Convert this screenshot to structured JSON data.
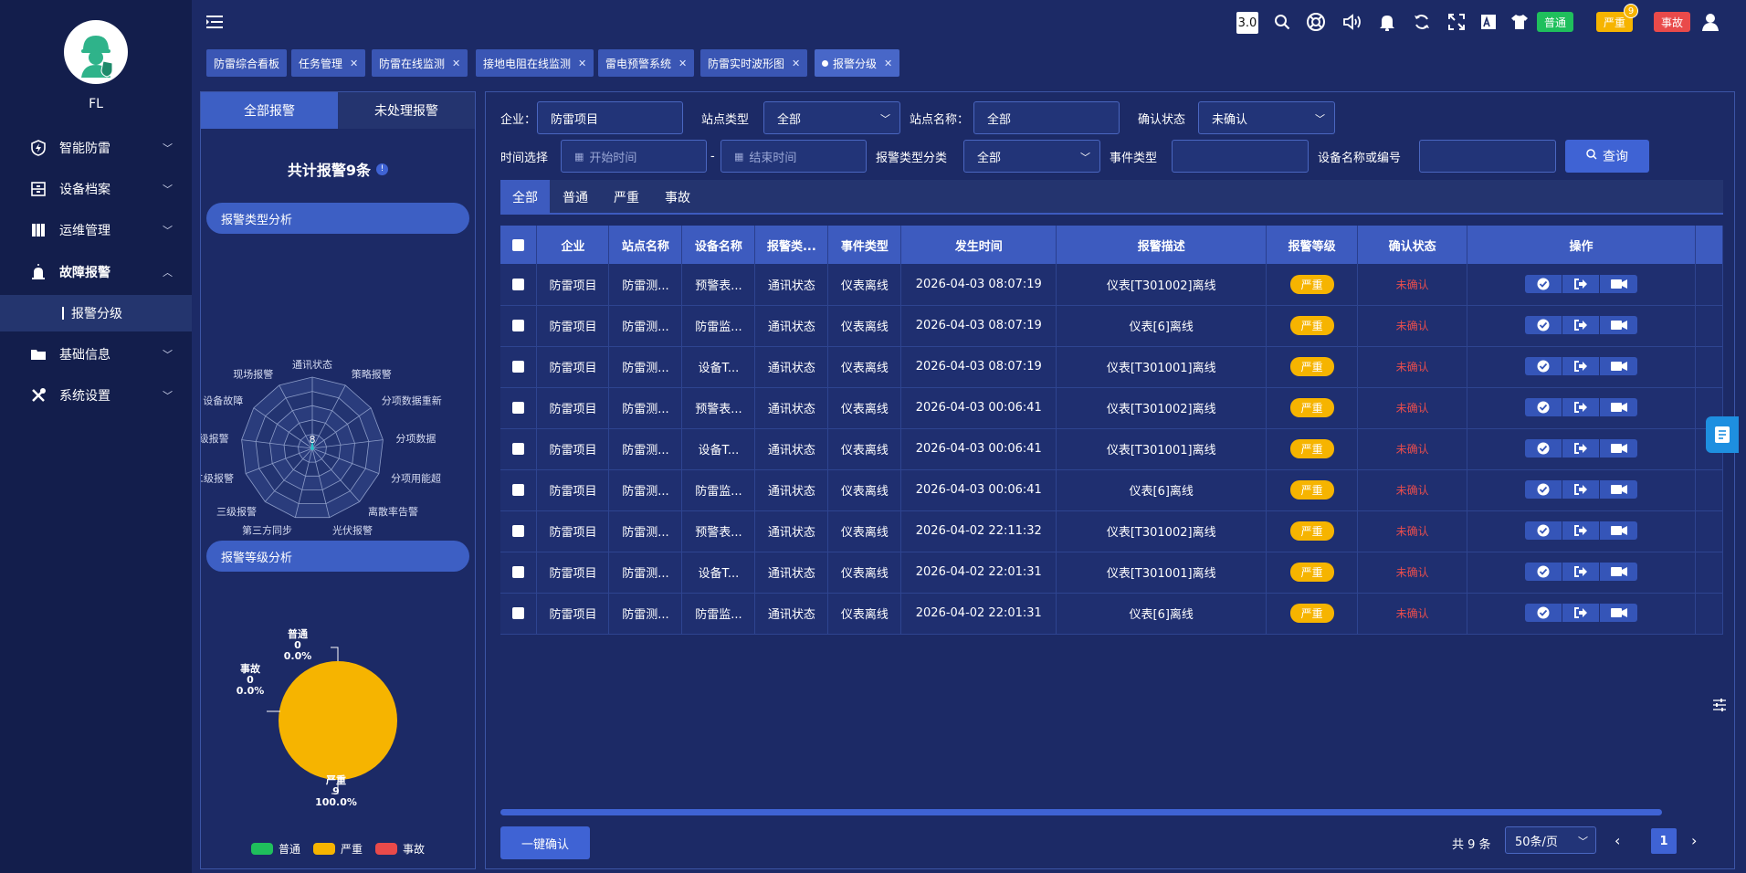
{
  "user": {
    "name": "FL"
  },
  "sidebar": {
    "items": [
      {
        "label": "智能防雷",
        "icon": "lightning-shield-icon"
      },
      {
        "label": "设备档案",
        "icon": "archive-icon"
      },
      {
        "label": "运维管理",
        "icon": "binders-icon"
      },
      {
        "label": "故障报警",
        "icon": "alarm-icon"
      },
      {
        "label": "基础信息",
        "icon": "folder-icon"
      },
      {
        "label": "系统设置",
        "icon": "tools-icon"
      }
    ],
    "sub_item": "报警分级"
  },
  "topbar": {
    "version": "3.0",
    "normal_label": "普通",
    "severe_label": "严重",
    "severe_count": "9",
    "accident_label": "事故",
    "colors": {
      "normal": "#1fbf5c",
      "severe": "#f6b400",
      "accident": "#e94a4a"
    }
  },
  "tabs": [
    {
      "label": "防雷综合看板",
      "closable": false
    },
    {
      "label": "任务管理",
      "closable": true
    },
    {
      "label": "防雷在线监测",
      "closable": true
    },
    {
      "label": "接地电阻在线监测",
      "closable": true
    },
    {
      "label": "雷电预警系统",
      "closable": true
    },
    {
      "label": "防雷实时波形图",
      "closable": true
    },
    {
      "label": "报警分级",
      "closable": true,
      "active": true
    }
  ],
  "left_panel": {
    "tab_all": "全部报警",
    "tab_unhandled": "未处理报警",
    "total_label": "共计报警9条",
    "type_analysis_title": "报警类型分析",
    "radar_labels": [
      "通讯状态",
      "策略报警",
      "分项数据重新",
      "分项数据",
      "分项用能超",
      "离散率告警",
      "光伏报警",
      "第三方同步",
      "三级报警",
      "二级报警",
      "一级报警",
      "设备故障",
      "现场报警"
    ],
    "radar_center_value": "8",
    "level_analysis_title": "报警等级分析",
    "pie": {
      "slices": [
        {
          "name": "普通",
          "value": 0,
          "pct": "0.0%",
          "color": "#1fbf5c"
        },
        {
          "name": "事故",
          "value": 0,
          "pct": "0.0%",
          "color": "#e94a4a"
        },
        {
          "name": "严重",
          "value": 9,
          "pct": "100.0%",
          "color": "#f6b400"
        }
      ]
    },
    "legend": [
      "普通",
      "严重",
      "事故"
    ]
  },
  "filters": {
    "company_label": "企业：",
    "company_value": "防雷项目",
    "site_type_label": "站点类型",
    "site_type_value": "全部",
    "site_name_label": "站点名称：",
    "site_name_value": "全部",
    "confirm_label": "确认状态",
    "confirm_value": "未确认",
    "time_label": "时间选择",
    "start_placeholder": "开始时间",
    "dash": "-",
    "end_placeholder": "结束时间",
    "alarm_class_label": "报警类型分类",
    "alarm_class_value": "全部",
    "event_type_label": "事件类型",
    "device_label": "设备名称或编号",
    "query_label": "查询"
  },
  "sub_tabs": [
    "全部",
    "普通",
    "严重",
    "事故"
  ],
  "table": {
    "headers": [
      "企业",
      "站点名称",
      "设备名称",
      "报警类...",
      "事件类型",
      "发生时间",
      "报警描述",
      "报警等级",
      "确认状态",
      "操作"
    ],
    "rows": [
      [
        "防雷项目",
        "防雷测...",
        "预警表...",
        "通讯状态",
        "仪表离线",
        "2026-04-03 08:07:19",
        "仪表[T301002]离线",
        "严重",
        "未确认"
      ],
      [
        "防雷项目",
        "防雷测...",
        "防雷监...",
        "通讯状态",
        "仪表离线",
        "2026-04-03 08:07:19",
        "仪表[6]离线",
        "严重",
        "未确认"
      ],
      [
        "防雷项目",
        "防雷测...",
        "设备T...",
        "通讯状态",
        "仪表离线",
        "2026-04-03 08:07:19",
        "仪表[T301001]离线",
        "严重",
        "未确认"
      ],
      [
        "防雷项目",
        "防雷测...",
        "预警表...",
        "通讯状态",
        "仪表离线",
        "2026-04-03 00:06:41",
        "仪表[T301002]离线",
        "严重",
        "未确认"
      ],
      [
        "防雷项目",
        "防雷测...",
        "设备T...",
        "通讯状态",
        "仪表离线",
        "2026-04-03 00:06:41",
        "仪表[T301001]离线",
        "严重",
        "未确认"
      ],
      [
        "防雷项目",
        "防雷测...",
        "防雷监...",
        "通讯状态",
        "仪表离线",
        "2026-04-03 00:06:41",
        "仪表[6]离线",
        "严重",
        "未确认"
      ],
      [
        "防雷项目",
        "防雷测...",
        "预警表...",
        "通讯状态",
        "仪表离线",
        "2026-04-02 22:11:32",
        "仪表[T301002]离线",
        "严重",
        "未确认"
      ],
      [
        "防雷项目",
        "防雷测...",
        "设备T...",
        "通讯状态",
        "仪表离线",
        "2026-04-02 22:01:31",
        "仪表[T301001]离线",
        "严重",
        "未确认"
      ],
      [
        "防雷项目",
        "防雷测...",
        "防雷监...",
        "通讯状态",
        "仪表离线",
        "2026-04-02 22:01:31",
        "仪表[6]离线",
        "严重",
        "未确认"
      ]
    ]
  },
  "footer": {
    "confirm_all": "一键确认",
    "total": "共 9 条",
    "page_size": "50条/页",
    "page": "1"
  }
}
